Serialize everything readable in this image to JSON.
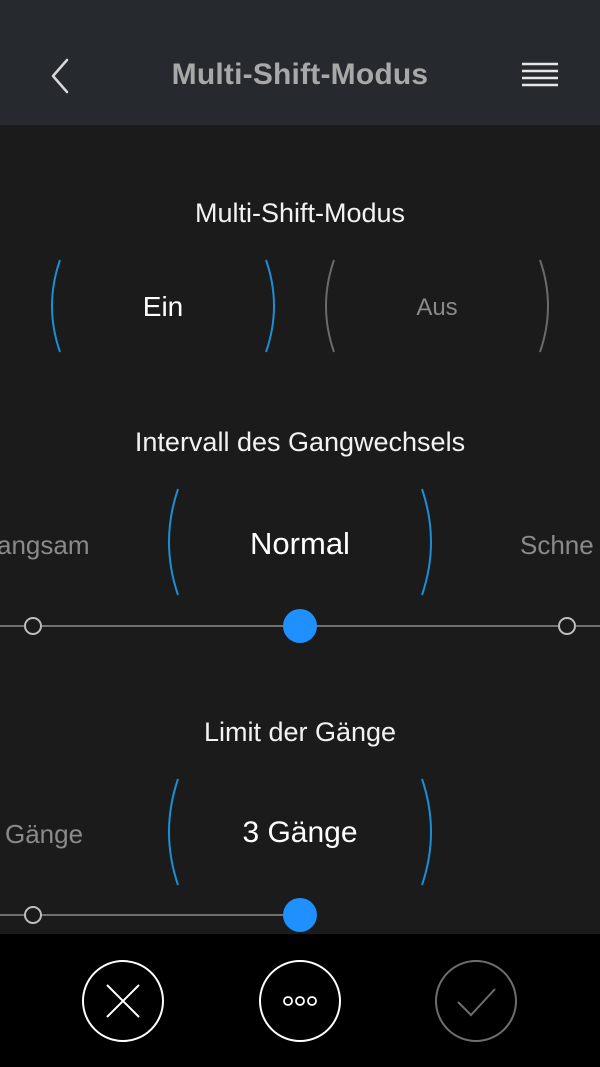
{
  "header": {
    "title": "Multi-Shift-Modus"
  },
  "mode": {
    "title": "Multi-Shift-Modus",
    "on_label": "Ein",
    "off_label": "Aus",
    "selected": "Ein"
  },
  "interval": {
    "title": "Intervall des Gangwechsels",
    "left_label": "angsam",
    "center_label": "Normal",
    "right_label": "Schne",
    "selected_index": 1,
    "option_count": 3
  },
  "gear_limit": {
    "title": "Limit der Gänge",
    "left_label": "Gänge",
    "center_label": "3 Gänge",
    "selected_index": 1
  },
  "colors": {
    "accent": "#1e90ff",
    "arc_active": "#1a8fd6",
    "arc_inactive": "#6a6a6a"
  }
}
